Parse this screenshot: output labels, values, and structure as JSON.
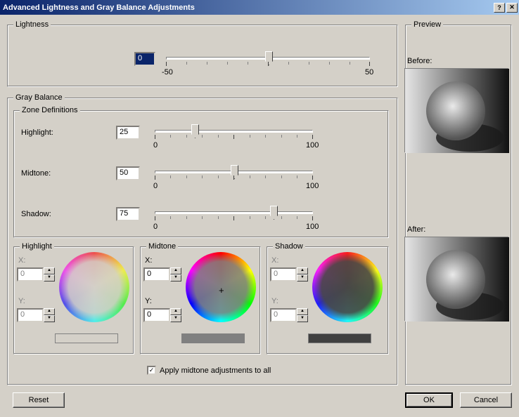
{
  "title": "Advanced Lightness and Gray Balance Adjustments",
  "lightness": {
    "legend": "Lightness",
    "value": "0",
    "min": "-50",
    "max": "50"
  },
  "grayBalance": {
    "legend": "Gray Balance",
    "zoneDefs": {
      "legend": "Zone Definitions",
      "highlight": {
        "label": "Highlight:",
        "value": "25"
      },
      "midtone": {
        "label": "Midtone:",
        "value": "50"
      },
      "shadow": {
        "label": "Shadow:",
        "value": "75"
      },
      "min": "0",
      "max": "100"
    },
    "panels": {
      "highlight": {
        "legend": "Highlight",
        "x": "0",
        "y": "0",
        "swatch": "#d4d0c8"
      },
      "midtone": {
        "legend": "Midtone",
        "x": "0",
        "y": "0",
        "swatch": "#808080"
      },
      "shadow": {
        "legend": "Shadow",
        "x": "0",
        "y": "0",
        "swatch": "#404040"
      }
    },
    "xLabel": "X:",
    "yLabel": "Y:",
    "applyMidtone": "Apply midtone adjustments to all",
    "applyMidtoneChecked": "✓"
  },
  "preview": {
    "legend": "Preview",
    "before": "Before:",
    "after": "After:"
  },
  "buttons": {
    "reset": "Reset",
    "ok": "OK",
    "cancel": "Cancel"
  },
  "helpGlyph": "?",
  "closeGlyph": "✕"
}
